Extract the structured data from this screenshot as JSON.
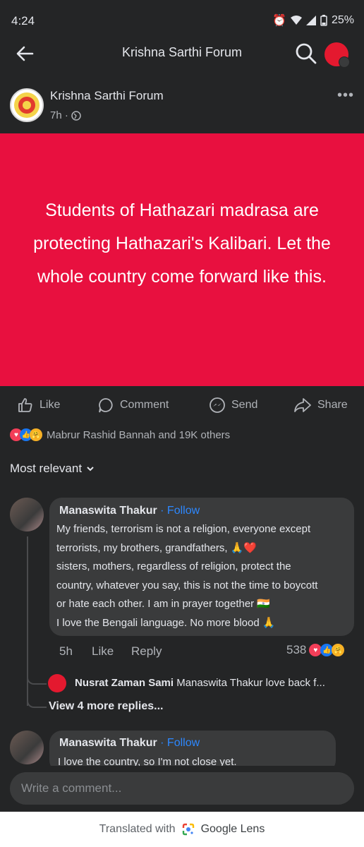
{
  "status_bar": {
    "time": "4:24",
    "battery": "25%"
  },
  "nav": {
    "title": "Krishna Sarthi Forum"
  },
  "post": {
    "group_name": "Krishna Sarthi Forum",
    "time": "7h ·",
    "image_text": "Students of Hathazari madrasa are protecting Hathazari's Kalibari. Let the whole country come forward like this.",
    "actions": {
      "like": "Like",
      "comment": "Comment",
      "send": "Send",
      "share": "Share"
    },
    "reactions_text": "Mabrur Rashid Bannah and 19K others",
    "sort_label": "Most relevant"
  },
  "comments": [
    {
      "author": "Manaswita Thakur",
      "follow": "· Follow",
      "lines": [
        "My friends, terrorism is not a religion, everyone except",
        "terrorists, my brothers, grandfathers, 🙏❤️",
        "sisters, mothers, regardless of religion, protect the",
        "country, whatever you say, this is not the time to boycott",
        "or hate each other. I am in prayer together 🇮🇳",
        "I love the Bengali language. No more blood 🙏"
      ],
      "time": "5h",
      "like": "Like",
      "reply": "Reply",
      "reaction_count": "538",
      "reply_preview": {
        "author": "Nusrat Zaman Sami",
        "text": "Manaswita Thakur love back f..."
      },
      "view_more": "View 4 more replies..."
    },
    {
      "author": "Manaswita Thakur",
      "follow": "· Follow",
      "lines": [
        "I love the country, so I'm not close yet."
      ]
    }
  ],
  "composer": {
    "placeholder": "Write a comment..."
  },
  "footer": {
    "text": "Translated with",
    "brand": "Google Lens"
  }
}
